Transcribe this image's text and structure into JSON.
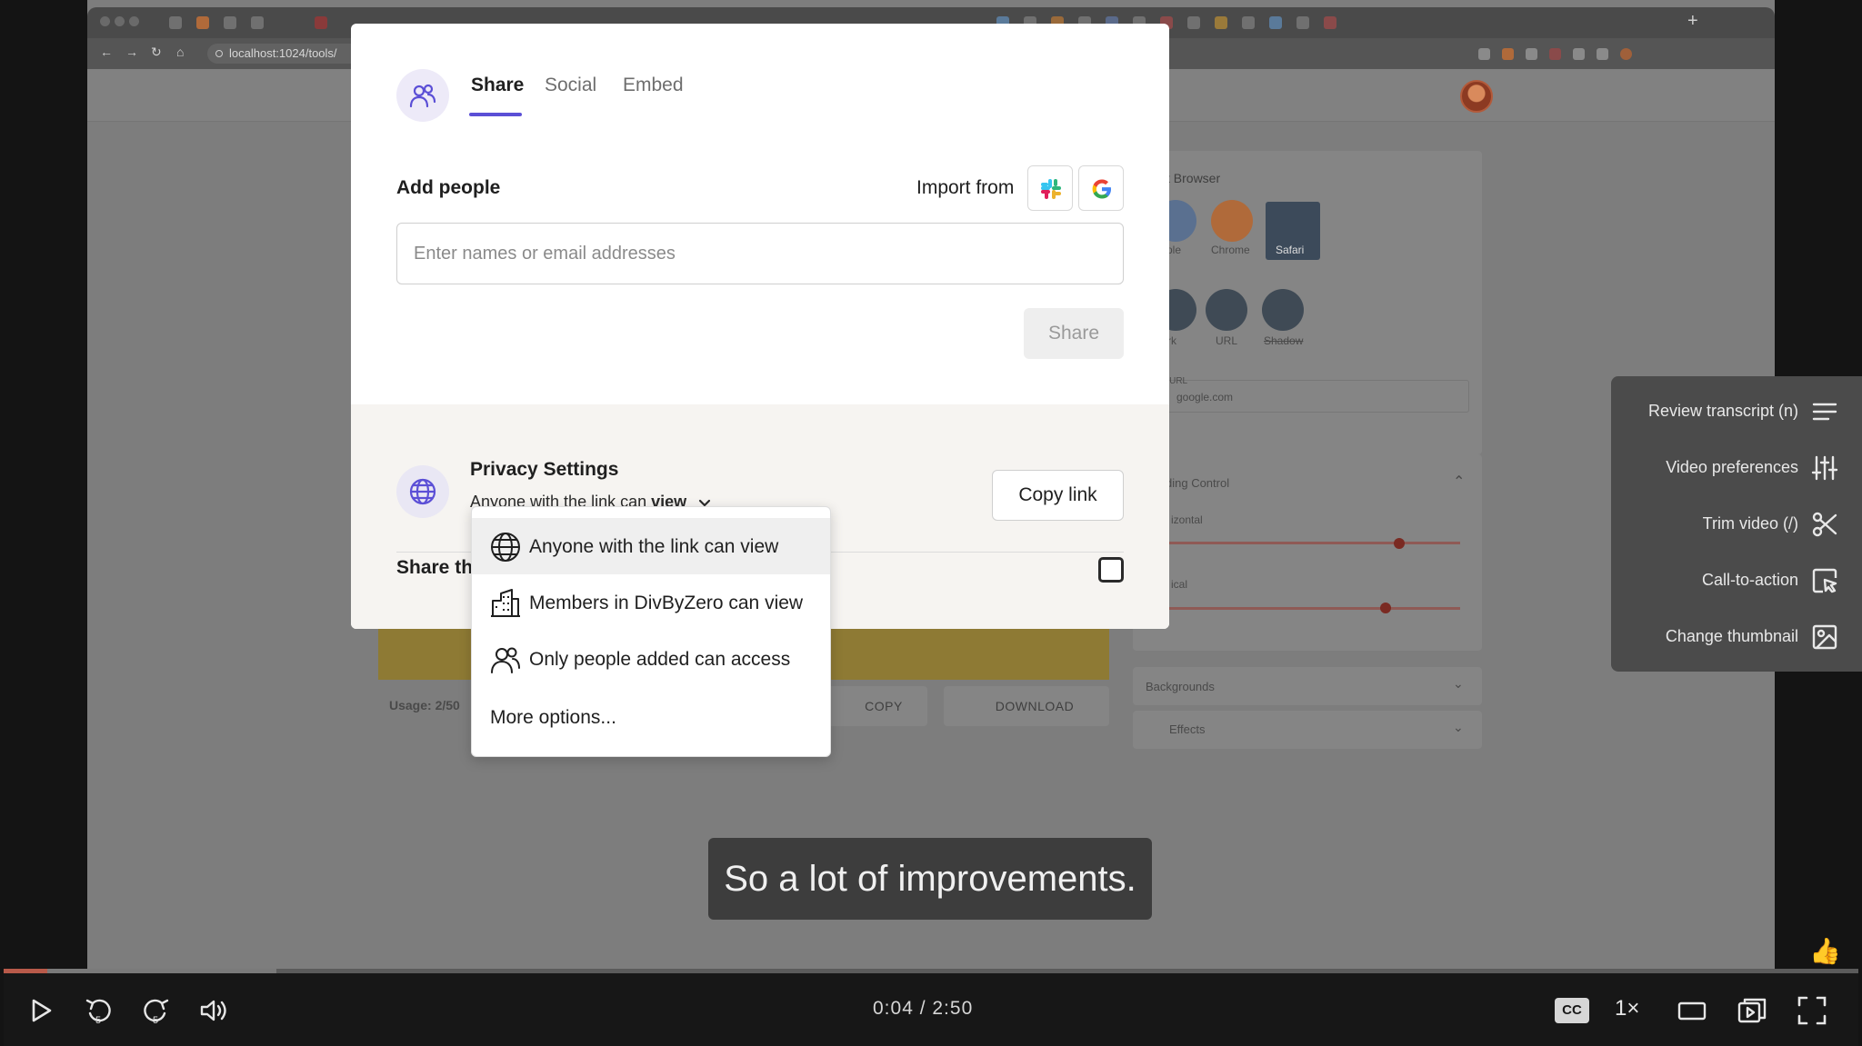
{
  "browser": {
    "address": "localhost:1024/tools/"
  },
  "background_app": {
    "section_title": "ct Browser",
    "browser_options": [
      "ple",
      "Chrome",
      "Safari"
    ],
    "frame_options": [
      "rk",
      "URL",
      "Shadow"
    ],
    "url_label": "r URL",
    "url_value": "google.com",
    "padding_control": "ding Control",
    "horizontal": "izontal",
    "vertical": "ical",
    "backgrounds": "Backgrounds",
    "effects": "Effects",
    "usage": "Usage: 2/50",
    "copy_btn": "COPY",
    "download_btn": "DOWNLOAD"
  },
  "modal": {
    "tabs": [
      "Share",
      "Social",
      "Embed"
    ],
    "add_people": "Add people",
    "import_from": "Import from",
    "email_placeholder": "Enter names or email addresses",
    "share_button": "Share",
    "privacy_title": "Privacy Settings",
    "privacy_prefix": "Anyone with the link can ",
    "privacy_level": "view",
    "copy_link": "Copy link",
    "share_this": "Share th"
  },
  "dropdown": {
    "options": [
      "Anyone with the link can view",
      "Members in DivByZero can view",
      "Only people added can access"
    ],
    "more": "More options..."
  },
  "side_menu": {
    "items": [
      "Review transcript (n)",
      "Video preferences",
      "Trim video (/)",
      "Call-to-action",
      "Change thumbnail"
    ]
  },
  "caption": "So a lot of improvements.",
  "player": {
    "timecode": "0:04 / 2:50",
    "progress": 0.0235,
    "cc": "CC",
    "speed": "1×"
  }
}
